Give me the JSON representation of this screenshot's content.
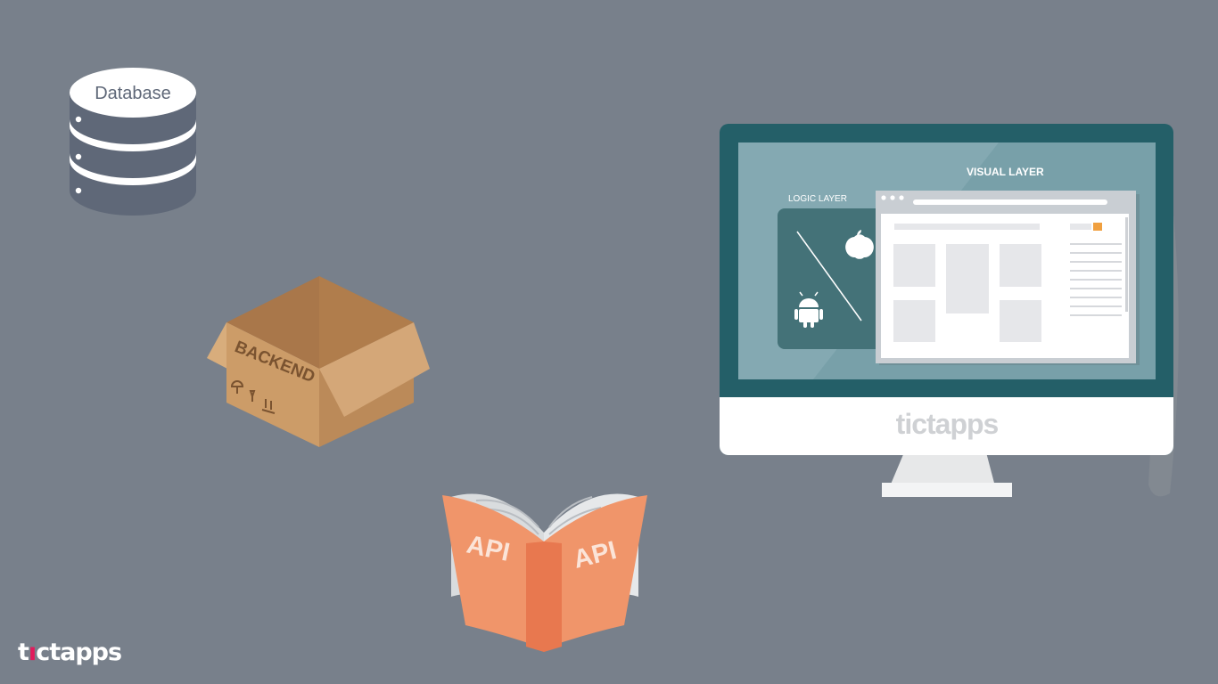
{
  "database": {
    "label": "Database"
  },
  "backend": {
    "label": "BACKEND"
  },
  "api": {
    "left_label": "API",
    "right_label": "API"
  },
  "monitor": {
    "logic_layer_label": "LOGIC LAYER",
    "visual_layer_label": "VISUAL LAYER",
    "brand": "tictapps"
  },
  "corner_logo": {
    "prefix": "t",
    "suffix": "ctapps"
  },
  "colors": {
    "background": "#78808b",
    "database": "#5f6878",
    "box": "#c99a68",
    "book": "#f0956a",
    "monitor_frame": "#245f68",
    "screen": "#84a9b2",
    "logic_panel": "#447278",
    "accent_pink": "#e11b5c",
    "accent_orange": "#f0a040"
  }
}
